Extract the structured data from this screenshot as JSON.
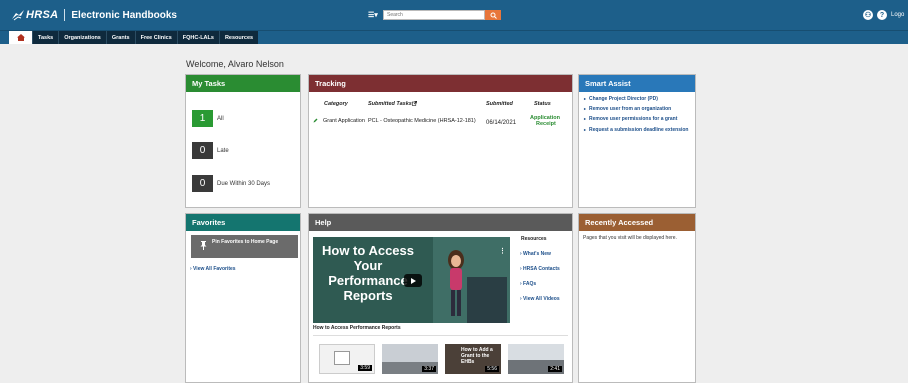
{
  "header": {
    "brand": "HRSA",
    "app_title": "Electronic Handbooks",
    "menu_icon": "menu-icon",
    "search_placeholder": "Search",
    "logout_label": "Logo"
  },
  "nav": {
    "tabs": [
      "Tasks",
      "Organizations",
      "Grants",
      "Free Clinics",
      "FQHC-LALs",
      "Resources"
    ]
  },
  "welcome": "Welcome, Alvaro Nelson",
  "my_tasks": {
    "title": "My Tasks",
    "items": [
      {
        "count": "1",
        "label": "All",
        "color": "#2a9a33"
      },
      {
        "count": "0",
        "label": "Late",
        "color": "#3a3a3a"
      },
      {
        "count": "0",
        "label": "Due Within 30 Days",
        "color": "#3a3a3a"
      }
    ]
  },
  "tracking": {
    "title": "Tracking",
    "headers": {
      "category": "Category",
      "submitted_tasks": "Submitted Tasks",
      "submitted": "Submitted",
      "status": "Status"
    },
    "row": {
      "category": "Grant Application",
      "task": "PCL - Osteopathic Medicine (HRSA-12-181)",
      "submitted": "06/14/2021",
      "status_line1": "Application",
      "status_line2": "Receipt"
    }
  },
  "smart_assist": {
    "title": "Smart Assist",
    "items": [
      "Change Project Director (PD)",
      "Remove user from an organization",
      "Remove user permissions for a grant",
      "Request a submission deadline extension"
    ]
  },
  "favorites": {
    "title": "Favorites",
    "pin_label": "Pin Favorites to Home Page",
    "view_all": "› View All Favorites"
  },
  "help": {
    "title": "Help",
    "video_text": "How to Access Your Performance Reports",
    "resources_title": "Resources",
    "links": [
      "› What's New",
      "› HRSA Contacts",
      "› FAQs",
      "› View All Videos"
    ],
    "video_title": "How to Access Performance Reports",
    "thumb_durations": [
      "3:59",
      "3:37",
      "5:56",
      "2:41"
    ],
    "thumb3_text": "How to Add a Grant to the EHBs"
  },
  "recently_accessed": {
    "title": "Recently Accessed",
    "text": "Pages that you visit will be displayed here."
  }
}
